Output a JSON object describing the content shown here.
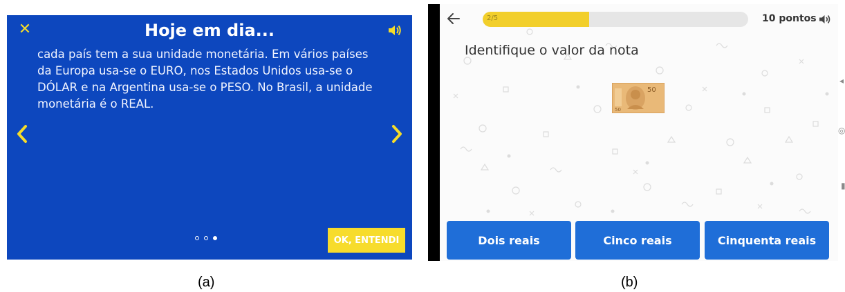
{
  "panel_a": {
    "title": "Hoje em dia...",
    "body": "cada país tem a sua unidade monetária. Em vários países da Europa usa-se o EURO, nos Estados Unidos usa-se o DÓLAR e na Argentina usa-se o PESO. No Brasil, a unidade monetária é o REAL.",
    "ok_button": "OK, ENTENDI",
    "page_dots": {
      "count": 3,
      "active_index": 2
    },
    "colors": {
      "background": "#0d47be",
      "accent": "#f5dc2a",
      "text": "#ffffff"
    },
    "icons": [
      "close-icon",
      "speaker-icon",
      "chevron-left-icon",
      "chevron-right-icon"
    ]
  },
  "panel_b": {
    "progress_label": "2/5",
    "progress_fraction": 0.4,
    "points": "10 pontos",
    "question": "Identifique o valor da nota",
    "banknote_value": "50",
    "answers": [
      "Dois reais",
      "Cinco reais",
      "Cinquenta reais"
    ],
    "colors": {
      "progress": "#f2cf2b",
      "answer_button": "#1f6ed8"
    },
    "icons": [
      "back-arrow-icon",
      "speaker-icon",
      "banknote-image"
    ]
  },
  "captions": {
    "a": "(a)",
    "b": "(b)"
  }
}
